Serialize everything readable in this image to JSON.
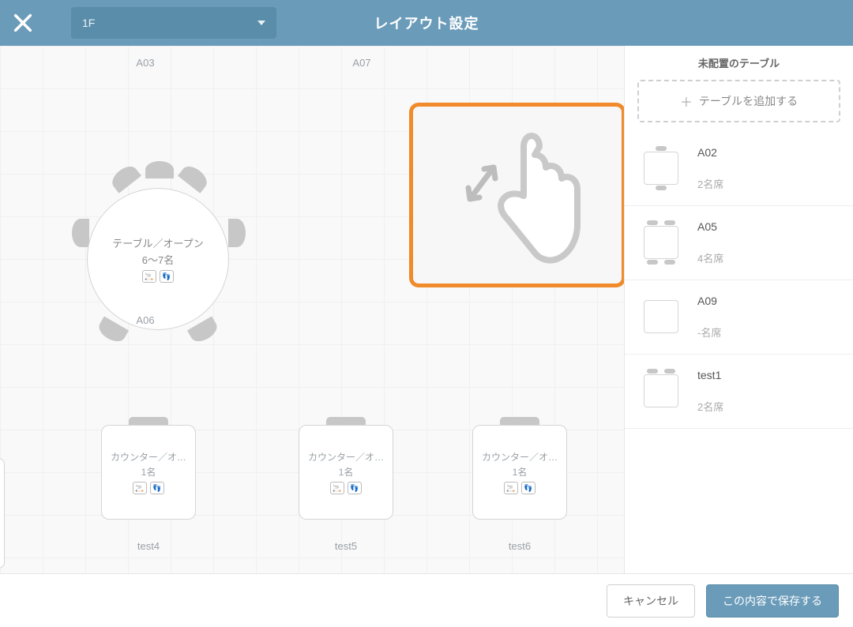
{
  "header": {
    "title": "レイアウト設定",
    "floor": "1F"
  },
  "canvas": {
    "labels": {
      "a03": "A03",
      "a07": "A07",
      "a06": "A06"
    },
    "round": {
      "type": "テーブル／オープン",
      "capacity": "6〜7名"
    },
    "counters": [
      {
        "type": "カウンター／オ…",
        "capacity": "1名",
        "label": "test4"
      },
      {
        "type": "カウンター／オ…",
        "capacity": "1名",
        "label": "test5"
      },
      {
        "type": "カウンター／オ…",
        "capacity": "1名",
        "label": "test6"
      }
    ]
  },
  "side": {
    "title": "未配置のテーブル",
    "add_label": "テーブルを追加する",
    "items": [
      {
        "name": "A02",
        "cap": "2名席",
        "seats": "2"
      },
      {
        "name": "A05",
        "cap": "4名席",
        "seats": "4"
      },
      {
        "name": "A09",
        "cap": "-名席",
        "seats": "0"
      },
      {
        "name": "test1",
        "cap": "2名席",
        "seats": "2b"
      }
    ]
  },
  "footer": {
    "cancel": "キャンセル",
    "save": "この内容で保存する"
  }
}
